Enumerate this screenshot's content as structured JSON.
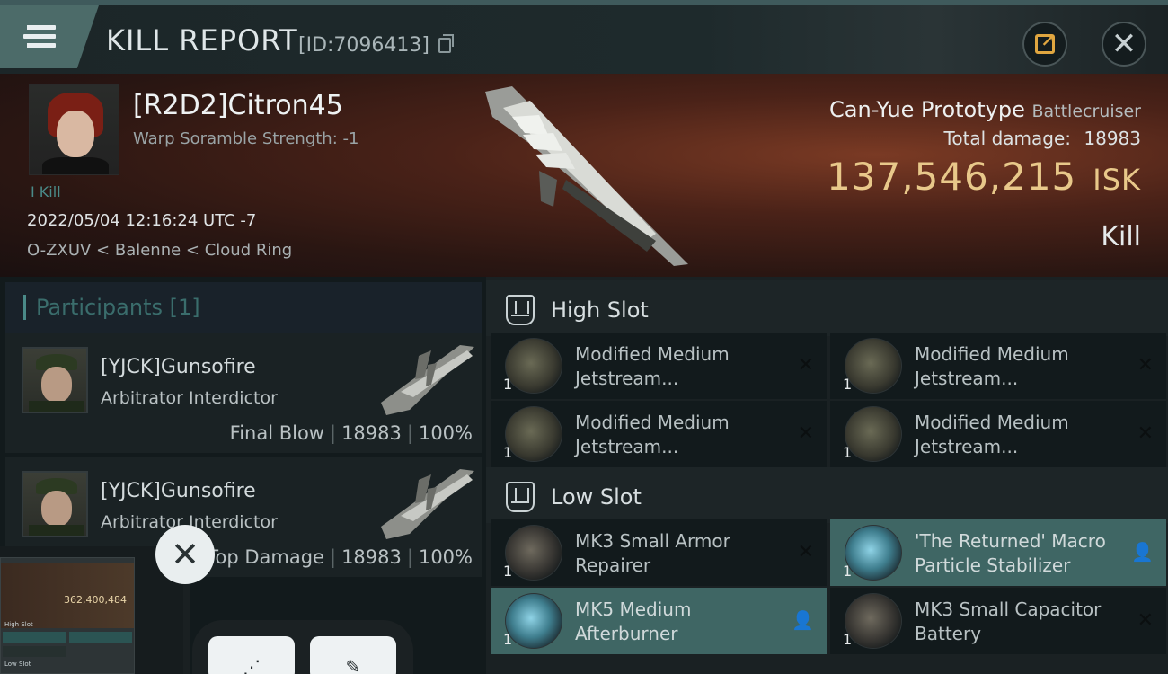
{
  "header": {
    "title": "KILL REPORT",
    "id_text": "[ID:7096413]",
    "share_icon": "share-icon",
    "close_icon": "close-icon"
  },
  "victim": {
    "pilot": "[R2D2]Citron45",
    "warp_scramble": "Warp Soramble Strength: -1",
    "kills": "I Kill",
    "datetime": "2022/05/04 12:16:24 UTC -7",
    "location": "O-ZXUV < Balenne < Cloud Ring",
    "ship_name": "Can-Yue Prototype",
    "ship_class": "Battlecruiser",
    "damage_label": "Total damage:",
    "damage_value": "18983",
    "isk_value": "137,546,215",
    "isk_unit": "ISK",
    "result": "Kill"
  },
  "participants": {
    "header": "Participants [1]",
    "rows": [
      {
        "name": "[YJCK]Gunsofire",
        "ship": "Arbitrator Interdictor",
        "role": "Final Blow",
        "damage": "18983",
        "percent": "100%"
      },
      {
        "name": "[YJCK]Gunsofire",
        "ship": "Arbitrator Interdictor",
        "role": "Top Damage",
        "damage": "18983",
        "percent": "100%"
      }
    ]
  },
  "fitting": {
    "high_slot": {
      "title": "High Slot",
      "modules": [
        {
          "qty": "1",
          "name": "Modified Medium Jetstream..."
        },
        {
          "qty": "1",
          "name": "Modified Medium Jetstream..."
        },
        {
          "qty": "1",
          "name": "Modified Medium Jetstream..."
        },
        {
          "qty": "1",
          "name": "Modified Medium Jetstream..."
        }
      ]
    },
    "low_slot": {
      "title": "Low Slot",
      "modules": [
        {
          "qty": "1",
          "name": "MK3 Small Armor Repairer"
        },
        {
          "qty": "1",
          "name": "'The Returned' Macro Particle Stabilizer"
        },
        {
          "qty": "1",
          "name": "MK5 Medium Afterburner"
        },
        {
          "qty": "1",
          "name": "MK3 Small Capacitor Battery"
        }
      ]
    }
  },
  "overlay": {
    "thumb_value": "362,400,484",
    "thumb_high": "High Slot",
    "thumb_low": "Low Slot"
  }
}
